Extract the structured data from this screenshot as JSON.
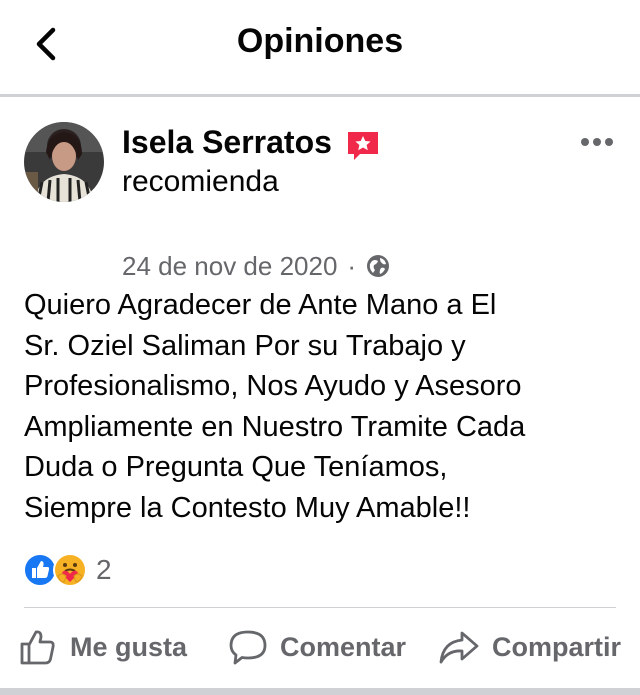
{
  "header": {
    "title": "Opiniones",
    "back_icon": "chevron-left-icon"
  },
  "post": {
    "author": {
      "name": "Isela Serratos",
      "badge_icon": "star-badge-icon",
      "action": "recomienda"
    },
    "date": "24 de nov de 2020",
    "separator": "·",
    "privacy_icon": "globe-icon",
    "more_icon": "more-horizontal-icon",
    "text": "Quiero Agradecer de Ante Mano a El\nSr. Oziel Saliman Por su Trabajo y\nProfesionalismo, Nos Ayudo y Asesoro\nAmpliamente en Nuestro Tramite Cada\nDuda o Pregunta Que Teníamos,\nSiempre la Contesto  Muy Amable!!",
    "reactions": {
      "icons": [
        "like-reaction-icon",
        "care-reaction-icon"
      ],
      "count": "2"
    }
  },
  "actions": {
    "like": "Me gusta",
    "comment": "Comentar",
    "share": "Compartir"
  },
  "colors": {
    "text_primary": "#050505",
    "text_secondary": "#65676b",
    "like_blue": "#1877f2",
    "badge_pink": "#f02849",
    "divider": "#cfd1d5"
  }
}
